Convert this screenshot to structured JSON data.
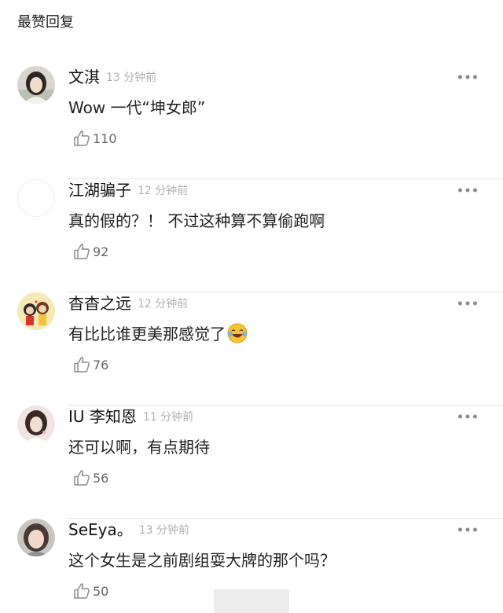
{
  "section": {
    "title": "最赞回复"
  },
  "comments": [
    {
      "username": "文淇",
      "time": "13 分钟前",
      "text": "Wow  一代“坤女郎”",
      "likes": "110",
      "avatar": "photo-girl-avatar"
    },
    {
      "username": "江湖骗子",
      "time": "12 分钟前",
      "text": "真的假的？！ 不过这种算不算偷跑啊",
      "likes": "92",
      "avatar": "blank-avatar"
    },
    {
      "username": "杳杳之远",
      "time": "12 分钟前",
      "text": "有比比谁更美那感觉了",
      "likes": "76",
      "avatar": "cartoon-avatar",
      "emoji": "laughing-tears-emoji"
    },
    {
      "username": "IU 李知恩",
      "time": "11 分钟前",
      "text": "还可以啊，有点期待",
      "likes": "56",
      "avatar": "photo-girl-avatar"
    },
    {
      "username": "SeEya。",
      "time": "13 分钟前",
      "text": "这个女生是之前剧组耍大牌的那个吗？",
      "likes": "50",
      "avatar": "photo-girl-avatar"
    }
  ],
  "colors": {
    "time": "#b0b0b0",
    "divider": "#e8e8e8",
    "icon": "#9a9a9a"
  }
}
